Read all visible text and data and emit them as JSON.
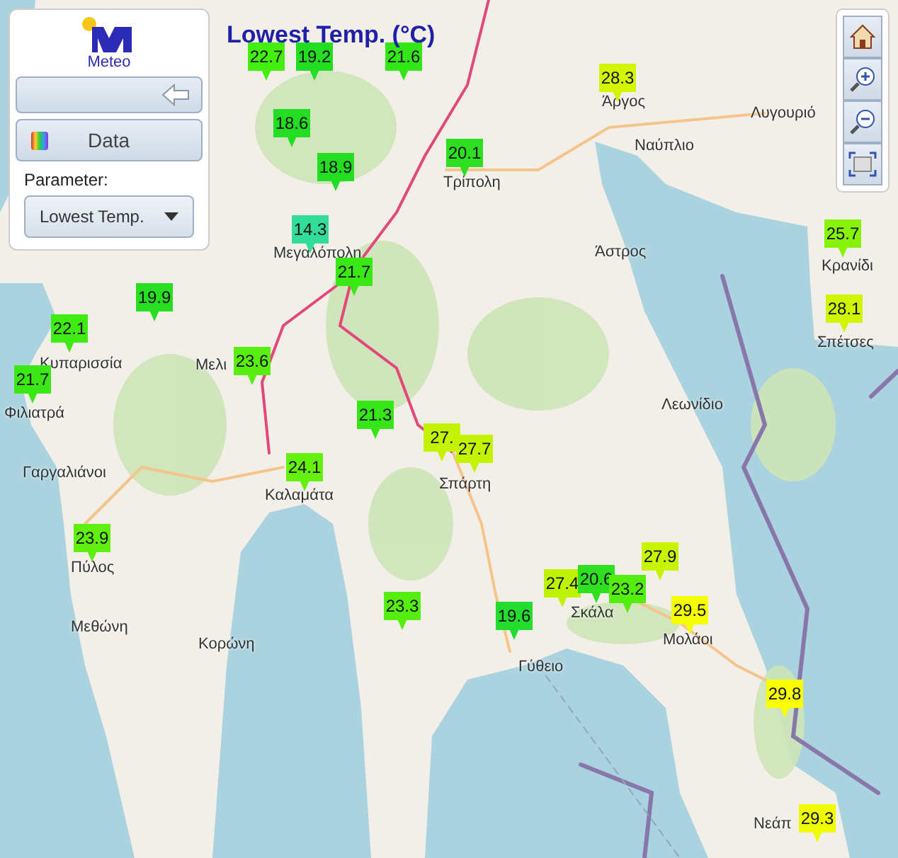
{
  "title": "Lowest Temp. (°C)",
  "panel": {
    "logo_text": "Meteo",
    "data_button": "Data",
    "parameter_label": "Parameter:",
    "parameter_value": "Lowest Temp."
  },
  "places": [
    "Άργος",
    "Λυγουριό",
    "Ναύπλιο",
    "Τρίπολη",
    "Άστρος",
    "Μεγαλόπολη",
    "Κρανίδι",
    "Σπέτσες",
    "Κυπαρισσία",
    "Μελι",
    "Φιλιατρά",
    "Γαργαλιάνοι",
    "Καλαμάτα",
    "Πύλος",
    "Μεθώνη",
    "Κορώνη",
    "Λεωνίδιο",
    "Σπάρτη",
    "Σκάλα",
    "Μολάοι",
    "Γύθειο",
    "Νεάπ"
  ],
  "markers": [
    {
      "value": "22.7",
      "color": "#44ee11"
    },
    {
      "value": "19.2",
      "color": "#22dd22"
    },
    {
      "value": "21.6",
      "color": "#33e618"
    },
    {
      "value": "28.3",
      "color": "#d4f500"
    },
    {
      "value": "18.6",
      "color": "#22dd22"
    },
    {
      "value": "18.9",
      "color": "#22dd22"
    },
    {
      "value": "20.1",
      "color": "#2ddf20"
    },
    {
      "value": "14.3",
      "color": "#33dd99"
    },
    {
      "value": "21.7",
      "color": "#3ae816"
    },
    {
      "value": "19.9",
      "color": "#28de22"
    },
    {
      "value": "22.1",
      "color": "#40ea14"
    },
    {
      "value": "23.6",
      "color": "#5aee10"
    },
    {
      "value": "21.7",
      "color": "#3ae816"
    },
    {
      "value": "21.3",
      "color": "#36e617"
    },
    {
      "value": "27.",
      "color": "#c4f404"
    },
    {
      "value": "27.7",
      "color": "#c4f404"
    },
    {
      "value": "24.1",
      "color": "#66f010"
    },
    {
      "value": "23.9",
      "color": "#60ef10"
    },
    {
      "value": "23.3",
      "color": "#56ee10"
    },
    {
      "value": "19.6",
      "color": "#24dc30"
    },
    {
      "value": "27.4",
      "color": "#bef205"
    },
    {
      "value": "20.6",
      "color": "#2ee020"
    },
    {
      "value": "23.2",
      "color": "#54ed10"
    },
    {
      "value": "27.9",
      "color": "#c8f404"
    },
    {
      "value": "29.5",
      "color": "#f4ff00"
    },
    {
      "value": "29.8",
      "color": "#f8ff00"
    },
    {
      "value": "29.3",
      "color": "#eefc00"
    },
    {
      "value": "25.7",
      "color": "#88f20a"
    },
    {
      "value": "28.1",
      "color": "#d0f502"
    }
  ]
}
